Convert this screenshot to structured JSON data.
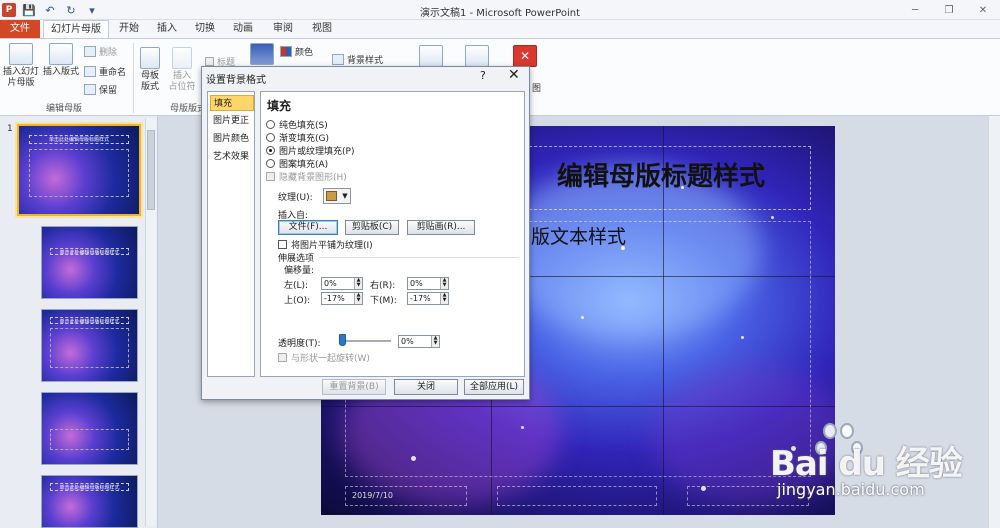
{
  "window": {
    "title": "演示文稿1 - Microsoft PowerPoint",
    "app_icon": "P"
  },
  "qat": {
    "save": "💾",
    "undo": "↶",
    "redo": "↻",
    "more": "▾"
  },
  "window_controls": {
    "minimize": "─",
    "restore": "❐",
    "close": "✕"
  },
  "tabs": [
    "文件",
    "幻灯片母版",
    "开始",
    "插入",
    "切换",
    "动画",
    "审阅",
    "视图"
  ],
  "ribbon": {
    "insert_master_l1": "插入幻灯",
    "insert_master_l2": "片母版",
    "insert_layout": "插入版式",
    "delete": "删除",
    "rename": "重命名",
    "preserve": "保留",
    "group_edit": "编辑母版",
    "master_layout_l1": "母板",
    "master_layout_l2": "版式",
    "insert_placeholder_l1": "插入",
    "insert_placeholder_l2": "占位符",
    "title_check": "标题",
    "group_layout": "母版版式",
    "colors": "颜色",
    "bg_styles": "背景样式",
    "side_label": "图"
  },
  "slide": {
    "title": "单击此处编辑母版标题样式",
    "title_visible": "编辑母版标题样式",
    "body_visible": "版文本样式",
    "date": "2019/7/10"
  },
  "thumbnails": {
    "first_number": "1"
  },
  "dialog": {
    "title": "设置背景格式",
    "help": "?",
    "close": "✕",
    "nav": [
      "填充",
      "图片更正",
      "图片颜色",
      "艺术效果"
    ],
    "heading": "填充",
    "radios": [
      "纯色填充(S)",
      "渐变填充(G)",
      "图片或纹理填充(P)",
      "图案填充(A)"
    ],
    "hide_bg": "隐藏背景图形(H)",
    "texture_label": "纹理(U):",
    "insert_from": "插入自:",
    "btn_file": "文件(F)...",
    "btn_clipboard": "剪贴板(C)",
    "btn_clipart": "剪贴画(R)...",
    "tile_check": "将图片平铺为纹理(I)",
    "stretch_options": "伸展选项",
    "offsets": "偏移量:",
    "left_label": "左(L):",
    "left_value": "0%",
    "right_label": "右(R):",
    "right_value": "0%",
    "top_label": "上(O):",
    "top_value": "-17%",
    "bottom_label": "下(M):",
    "bottom_value": "-17%",
    "transparency_label": "透明度(T):",
    "transparency_value": "0%",
    "rotate_with_shape": "与形状一起旋转(W)",
    "btn_reset": "重置背景(B)",
    "btn_close": "关闭",
    "btn_apply_all": "全部应用(L)"
  },
  "watermark": {
    "brand": "Bai du 经验",
    "url": "jingyan.baidu.com"
  },
  "colors": {
    "file_tab": "#d24726",
    "selected_nav": "#fcd66a",
    "accent": "#2a78c8"
  }
}
